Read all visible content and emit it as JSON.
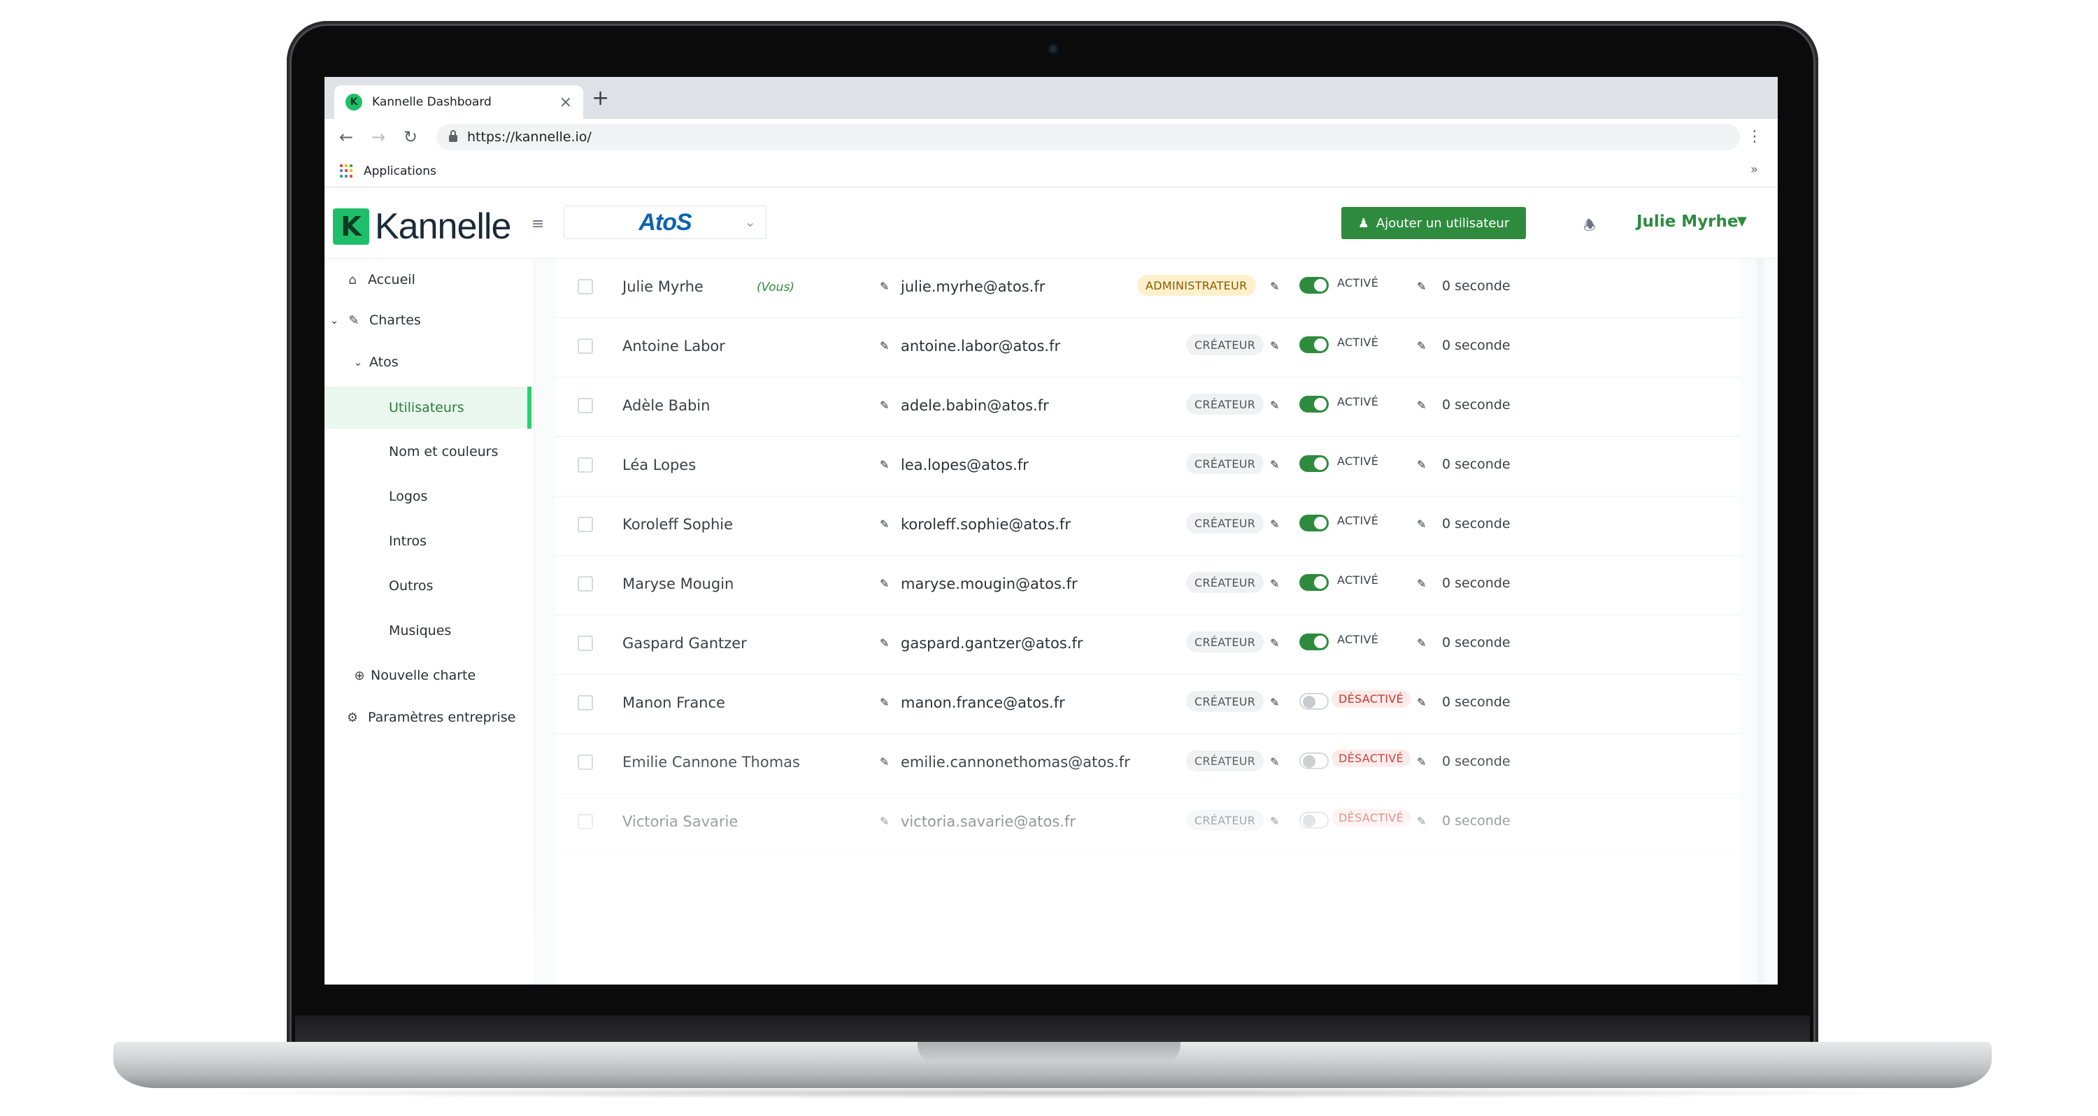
{
  "browser": {
    "tab_title": "Kannelle Dashboard",
    "tab_close": "×",
    "new_tab": "+",
    "url": "https://kannelle.io/",
    "bookmark_label": "Applications",
    "bookmark_more": "»",
    "app_grid_colors": [
      "#ea4335",
      "#fbbc05",
      "#34a853",
      "#4285f4",
      "#ea4335",
      "#fbbc05",
      "#34a853",
      "#4285f4",
      "#ea4335"
    ]
  },
  "header": {
    "logo_mark": "K",
    "logo_text": "Kannelle",
    "org_name": "AtoS",
    "add_user_label": "Ajouter un utilisateur",
    "user_name": "Julie Myrhe"
  },
  "colors": {
    "brand_green": "#1fbf6a",
    "primary_green": "#2e8b3e",
    "admin_badge": "#fff0cc",
    "inactive_red": "#c0392b"
  },
  "sidebar": {
    "items": [
      {
        "label": "Accueil",
        "icon": "home-icon"
      },
      {
        "label": "Chartes",
        "icon": "brush-icon"
      },
      {
        "label": "Atos",
        "icon": "chevron-down-icon"
      },
      {
        "label": "Utilisateurs",
        "active": true
      },
      {
        "label": "Nom et couleurs"
      },
      {
        "label": "Logos"
      },
      {
        "label": "Intros"
      },
      {
        "label": "Outros"
      },
      {
        "label": "Musiques"
      },
      {
        "label": "Nouvelle charte",
        "icon": "plus-circle-icon"
      },
      {
        "label": "Paramètres entreprise",
        "icon": "gear-icon"
      }
    ]
  },
  "users": {
    "you_label": "(Vous)",
    "rows": [
      {
        "name": "Julie Myrhe",
        "email": "julie.myrhe@atos.fr",
        "role": "ADMINISTRATEUR",
        "status": "ACTIVÉ",
        "duration": "0 seconde"
      },
      {
        "name": "Antoine Labor",
        "email": "antoine.labor@atos.fr",
        "role": "CRÉATEUR",
        "status": "ACTIVÉ",
        "duration": "0 seconde"
      },
      {
        "name": "Adèle Babin",
        "email": "adele.babin@atos.fr",
        "role": "CRÉATEUR",
        "status": "ACTIVÉ",
        "duration": "0 seconde"
      },
      {
        "name": "Léa Lopes",
        "email": "lea.lopes@atos.fr",
        "role": "CRÉATEUR",
        "status": "ACTIVÉ",
        "duration": "0 seconde"
      },
      {
        "name": "Koroleff Sophie",
        "email": "koroleff.sophie@atos.fr",
        "role": "CRÉATEUR",
        "status": "ACTIVÉ",
        "duration": "0 seconde"
      },
      {
        "name": "Maryse Mougin",
        "email": "maryse.mougin@atos.fr",
        "role": "CRÉATEUR",
        "status": "ACTIVÉ",
        "duration": "0 seconde"
      },
      {
        "name": "Gaspard Gantzer",
        "email": "gaspard.gantzer@atos.fr",
        "role": "CRÉATEUR",
        "status": "ACTIVÉ",
        "duration": "0 seconde"
      },
      {
        "name": "Manon France",
        "email": "manon.france@atos.fr",
        "role": "CRÉATEUR",
        "status": "DÉSACTIVÉ",
        "duration": "0 seconde"
      },
      {
        "name": "Emilie Cannone Thomas",
        "email": "emilie.cannonethomas@atos.fr",
        "role": "CRÉATEUR",
        "status": "DÉSACTIVÉ",
        "duration": "0 seconde"
      },
      {
        "name": "Victoria Savarie",
        "email": "victoria.savarie@atos.fr",
        "role": "CRÉATEUR",
        "status": "DÉSACTIVÉ",
        "duration": "0 seconde"
      }
    ]
  }
}
